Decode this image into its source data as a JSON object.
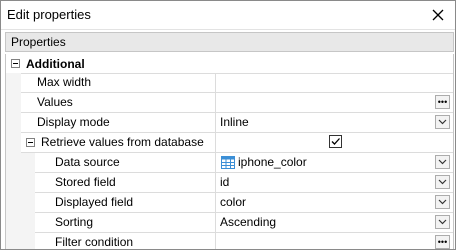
{
  "window": {
    "title": "Edit properties"
  },
  "header": {
    "label": "Properties"
  },
  "group": {
    "label": "Additional"
  },
  "rows": [
    {
      "name": "Max width",
      "value": ""
    },
    {
      "name": "Values",
      "value": ""
    },
    {
      "name": "Display mode",
      "value": "Inline"
    },
    {
      "name": "Retrieve values from database",
      "value": "",
      "checked": true
    },
    {
      "name": "Data source",
      "value": "iphone_color"
    },
    {
      "name": "Stored field",
      "value": "id"
    },
    {
      "name": "Displayed field",
      "value": "color"
    },
    {
      "name": "Sorting",
      "value": "Ascending"
    },
    {
      "name": "Filter condition",
      "value": ""
    }
  ],
  "icons": {
    "close": "close-icon",
    "collapse": "collapse-toggle-icon",
    "ellipsis": "ellipsis-icon",
    "dropdown": "chevron-down-icon",
    "table": "table-icon",
    "checkbox": "checkbox-checked-icon"
  },
  "colors": {
    "table_icon": "#3c8fd6",
    "grid_line": "#dcdcdc"
  }
}
